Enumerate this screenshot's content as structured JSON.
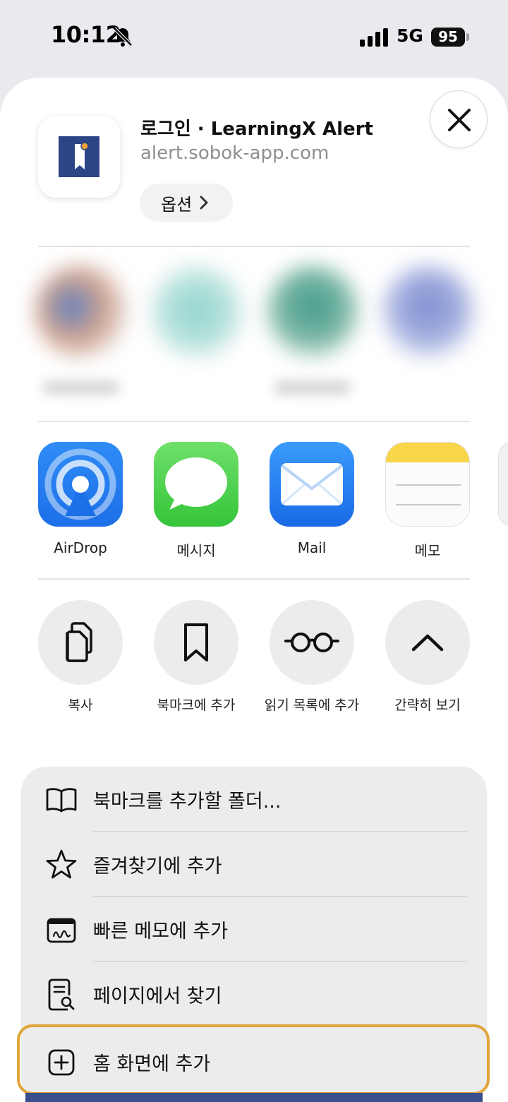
{
  "status_bar": {
    "time": "10:12",
    "network": "5G",
    "battery": "95"
  },
  "share_sheet": {
    "title": "로그인 · LearningX Alert",
    "url": "alert.sobok-app.com",
    "options_label": "옵션",
    "apps": [
      {
        "label": "AirDrop",
        "icon": "airdrop-icon"
      },
      {
        "label": "메시지",
        "icon": "messages-icon"
      },
      {
        "label": "Mail",
        "icon": "mail-icon"
      },
      {
        "label": "메모",
        "icon": "notes-icon"
      }
    ],
    "actions": [
      {
        "label": "복사",
        "icon": "copy-icon"
      },
      {
        "label": "북마크에 추가",
        "icon": "bookmark-icon"
      },
      {
        "label": "읽기 목록에 추가",
        "icon": "glasses-icon"
      },
      {
        "label": "간략히 보기",
        "icon": "chevron-up-icon"
      }
    ],
    "menu": [
      {
        "label": "북마크를 추가할 폴더...",
        "icon": "book-icon"
      },
      {
        "label": "즐겨찾기에 추가",
        "icon": "star-icon"
      },
      {
        "label": "빠른 메모에 추가",
        "icon": "quick-note-icon"
      },
      {
        "label": "페이지에서 찾기",
        "icon": "find-in-page-icon"
      },
      {
        "label": "홈 화면에 추가",
        "icon": "add-square-icon"
      }
    ]
  },
  "colors": {
    "highlight": "#e0a53a",
    "app_tile": "#2c4585"
  }
}
